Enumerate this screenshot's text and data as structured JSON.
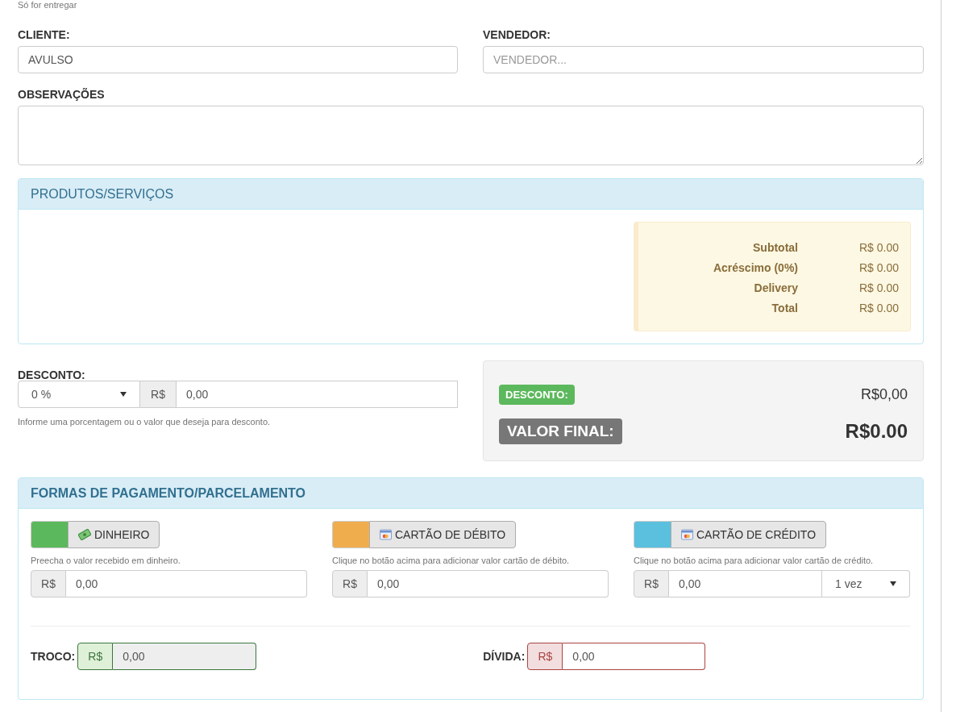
{
  "delivery_note": "Só for entregar",
  "cliente": {
    "label": "CLIENTE:",
    "value": "AVULSO"
  },
  "vendedor": {
    "label": "VENDEDOR:",
    "placeholder": "VENDEDOR..."
  },
  "observacoes": {
    "label": "OBSERVAÇÕES"
  },
  "products_panel": {
    "title": "PRODUTOS/SERVIÇOS",
    "summary": [
      {
        "label": "Subtotal",
        "value": "R$ 0.00"
      },
      {
        "label": "Acréscimo (0%)",
        "value": "R$ 0.00"
      },
      {
        "label": "Delivery",
        "value": "R$ 0.00"
      },
      {
        "label": "Total",
        "value": "R$ 0.00"
      }
    ]
  },
  "desconto": {
    "label": "DESCONTO:",
    "select": "0 %",
    "prefix": "R$",
    "value": "0,00",
    "help": "Informe uma porcentagem ou o valor que deseja para desconto."
  },
  "totals": {
    "discount_badge": "DESCONTO:",
    "discount_value": "R$0,00",
    "final_badge": "VALOR FINAL:",
    "final_value": "R$0.00"
  },
  "payments": {
    "title": "FORMAS DE PAGAMENTO/PARCELAMENTO",
    "methods": [
      {
        "kind": "cash",
        "label": "DINHEIRO",
        "color": "#5cb85c",
        "hint": "Preecha o valor recebido em dinheiro.",
        "prefix": "R$",
        "value": "0,00"
      },
      {
        "kind": "card",
        "label": "CARTÃO DE DÉBITO",
        "color": "#f0ad4e",
        "hint": "Clique no botão acima para adicionar valor cartão de débito.",
        "prefix": "R$",
        "value": "0,00"
      },
      {
        "kind": "card",
        "label": "CARTÃO DE CRÉDITO",
        "color": "#5bc0de",
        "hint": "Clique no botão acima para adicionar valor cartão de crédito.",
        "prefix": "R$",
        "value": "0,00",
        "installments": "1 vez"
      }
    ],
    "troco": {
      "label": "TROCO:",
      "prefix": "R$",
      "value": "0,00"
    },
    "divida": {
      "label": "DÍVIDA:",
      "prefix": "R$",
      "value": "0,00"
    }
  }
}
